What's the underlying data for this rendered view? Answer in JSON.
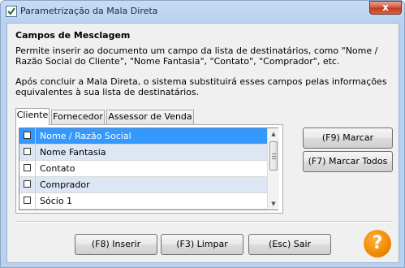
{
  "window": {
    "title": "Parametrização da Mala Direta",
    "close_label": "x"
  },
  "section": {
    "heading": "Campos de Mesclagem",
    "description_1": "Permite inserir ao documento um campo da lista de destinatários, como \"Nome / Razão Social do Cliente\", \"Nome Fantasia\", \"Contato\", \"Comprador\", etc.",
    "description_2": "Após concluir a Mala Direta, o sistema substituirá esses campos pelas informações equivalentes à sua lista de destinatários."
  },
  "tabs": [
    {
      "label": "Cliente",
      "active": true
    },
    {
      "label": "Fornecedor",
      "active": false
    },
    {
      "label": "Assessor de Venda",
      "active": false
    }
  ],
  "fields": [
    {
      "label": "Nome / Razão Social",
      "checked": false,
      "selected": true
    },
    {
      "label": "Nome Fantasia",
      "checked": false,
      "selected": false
    },
    {
      "label": "Contato",
      "checked": false,
      "selected": false
    },
    {
      "label": "Comprador",
      "checked": false,
      "selected": false
    },
    {
      "label": "Sócio 1",
      "checked": false,
      "selected": false
    }
  ],
  "side_buttons": {
    "mark": "(F9) Marcar",
    "mark_all": "(F7) Marcar Todos"
  },
  "footer_buttons": {
    "insert": "(F8) Inserir",
    "clear": "(F3) Limpar",
    "exit": "(Esc) Sair"
  },
  "help": {
    "label": "?"
  },
  "icons": {
    "app": "checkbox-window-icon",
    "close": "close-icon",
    "help": "help-icon",
    "scroll_up": "triangle-up-icon",
    "scroll_down": "triangle-down-icon"
  },
  "colors": {
    "selection": "#3399ff",
    "alt_row": "#dce6f4",
    "help": "#f08a00",
    "close": "#c13a1f"
  }
}
